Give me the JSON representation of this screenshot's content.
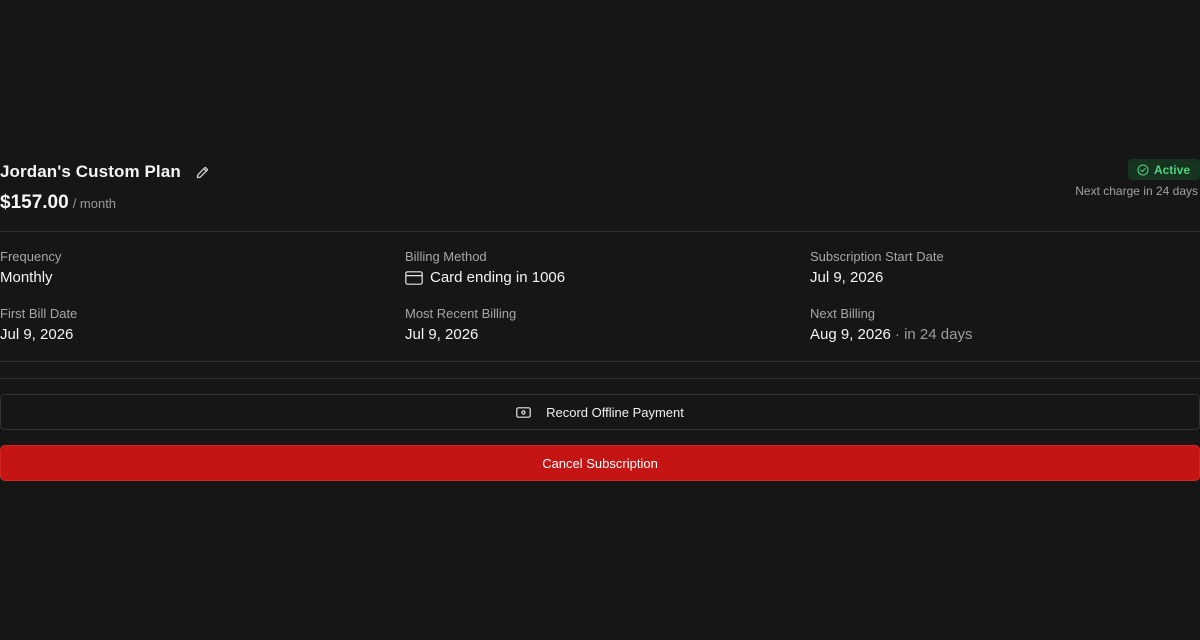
{
  "plan": {
    "name": "Jordan's Custom Plan",
    "price": "$157.00",
    "period": "/ month"
  },
  "status": {
    "label": "Active",
    "next_charge": "Next charge in 24 days",
    "color": "#4fcf7c"
  },
  "details": {
    "frequency": {
      "label": "Frequency",
      "value": "Monthly"
    },
    "billing_method": {
      "label": "Billing Method",
      "value": "Card ending in 1006",
      "icon": "credit-card-icon"
    },
    "start_date": {
      "label": "Subscription Start Date",
      "value": "Jul 9, 2026"
    },
    "first_bill": {
      "label": "First Bill Date",
      "value": "Jul 9, 2026"
    },
    "recent_billing": {
      "label": "Most Recent Billing",
      "value": "Jul 9, 2026"
    },
    "next_billing": {
      "label": "Next Billing",
      "value": "Aug 9, 2026",
      "suffix": "· in 24 days"
    }
  },
  "actions": {
    "record_payment": "Record Offline Payment",
    "cancel": "Cancel Subscription",
    "danger_color": "#c41414"
  }
}
